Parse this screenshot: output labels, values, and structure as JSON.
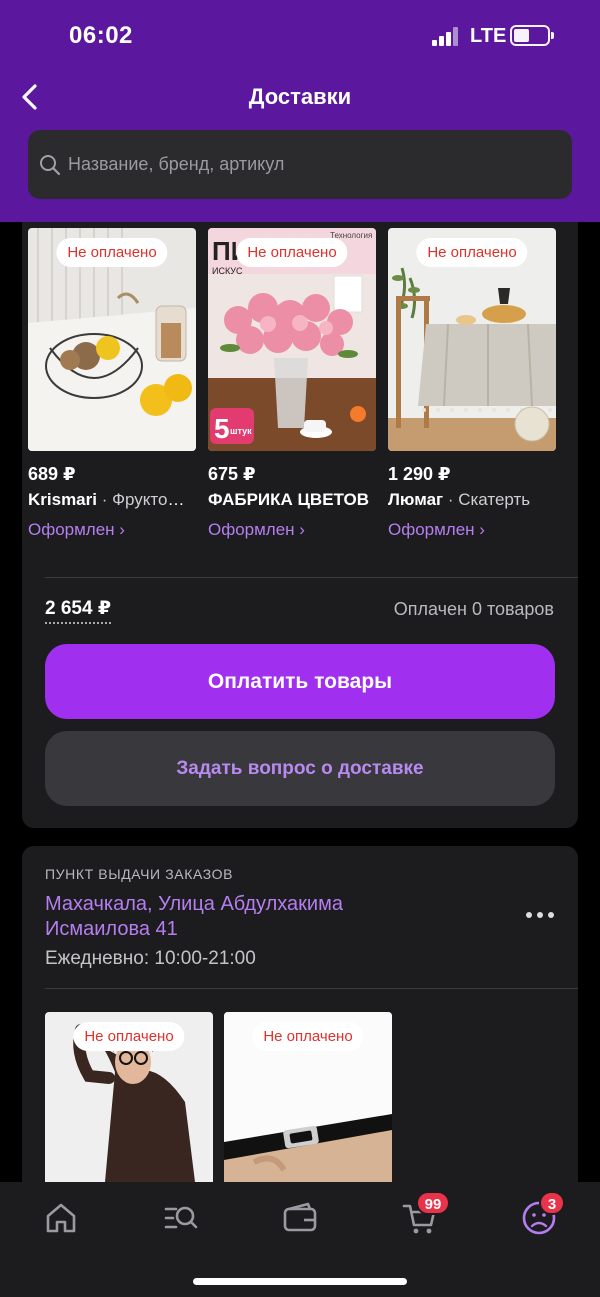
{
  "status_bar": {
    "time": "06:02",
    "network": "LTE"
  },
  "header": {
    "title": "Доставки"
  },
  "search": {
    "placeholder": "Название, бренд, артикул"
  },
  "order_block": {
    "items": [
      {
        "badge": "Не оплачено",
        "price": "689 ₽",
        "brand": "Krismari",
        "name": " · Фруктовница",
        "status": "Оформлен ›"
      },
      {
        "badge": "Не оплачено",
        "price": "675 ₽",
        "brand": "ФАБРИКА ЦВЕТОВ",
        "name": "",
        "status": "Оформлен ›"
      },
      {
        "badge": "Не оплачено",
        "price": "1 290 ₽",
        "brand": "Люмаг",
        "name": " · Скатерть",
        "status": "Оформлен ›"
      }
    ],
    "image_text": {
      "flower_promo_top": "ПИ",
      "flower_promo_sub": "ИСКУС",
      "flower_tech": "Технология",
      "flower_count": "5",
      "flower_count_unit": "штук"
    },
    "total": "2 654 ₽",
    "paid_info": "Оплачен 0 товаров",
    "pay_button": "Оплатить товары",
    "ask_button": "Задать вопрос о доставке"
  },
  "pickup_block": {
    "label": "ПУНКТ ВЫДАЧИ ЗАКАЗОВ",
    "address": "Махачкала, Улица Абдулхакима Исмаилова 41",
    "hours": "Ежедневно: 10:00-21:00",
    "items": [
      {
        "badge": "Не оплачено"
      },
      {
        "badge": "Не оплачено"
      }
    ]
  },
  "tabbar": {
    "tabs": [
      "home-icon",
      "catalog-search-icon",
      "wallet-icon",
      "cart-icon",
      "profile-icon"
    ],
    "cart_count": "99",
    "profile_count": "3"
  },
  "colors": {
    "header": "#5b189e",
    "accent": "#a02ff0",
    "link": "#b57ef0",
    "badge_text": "#e0312a"
  }
}
